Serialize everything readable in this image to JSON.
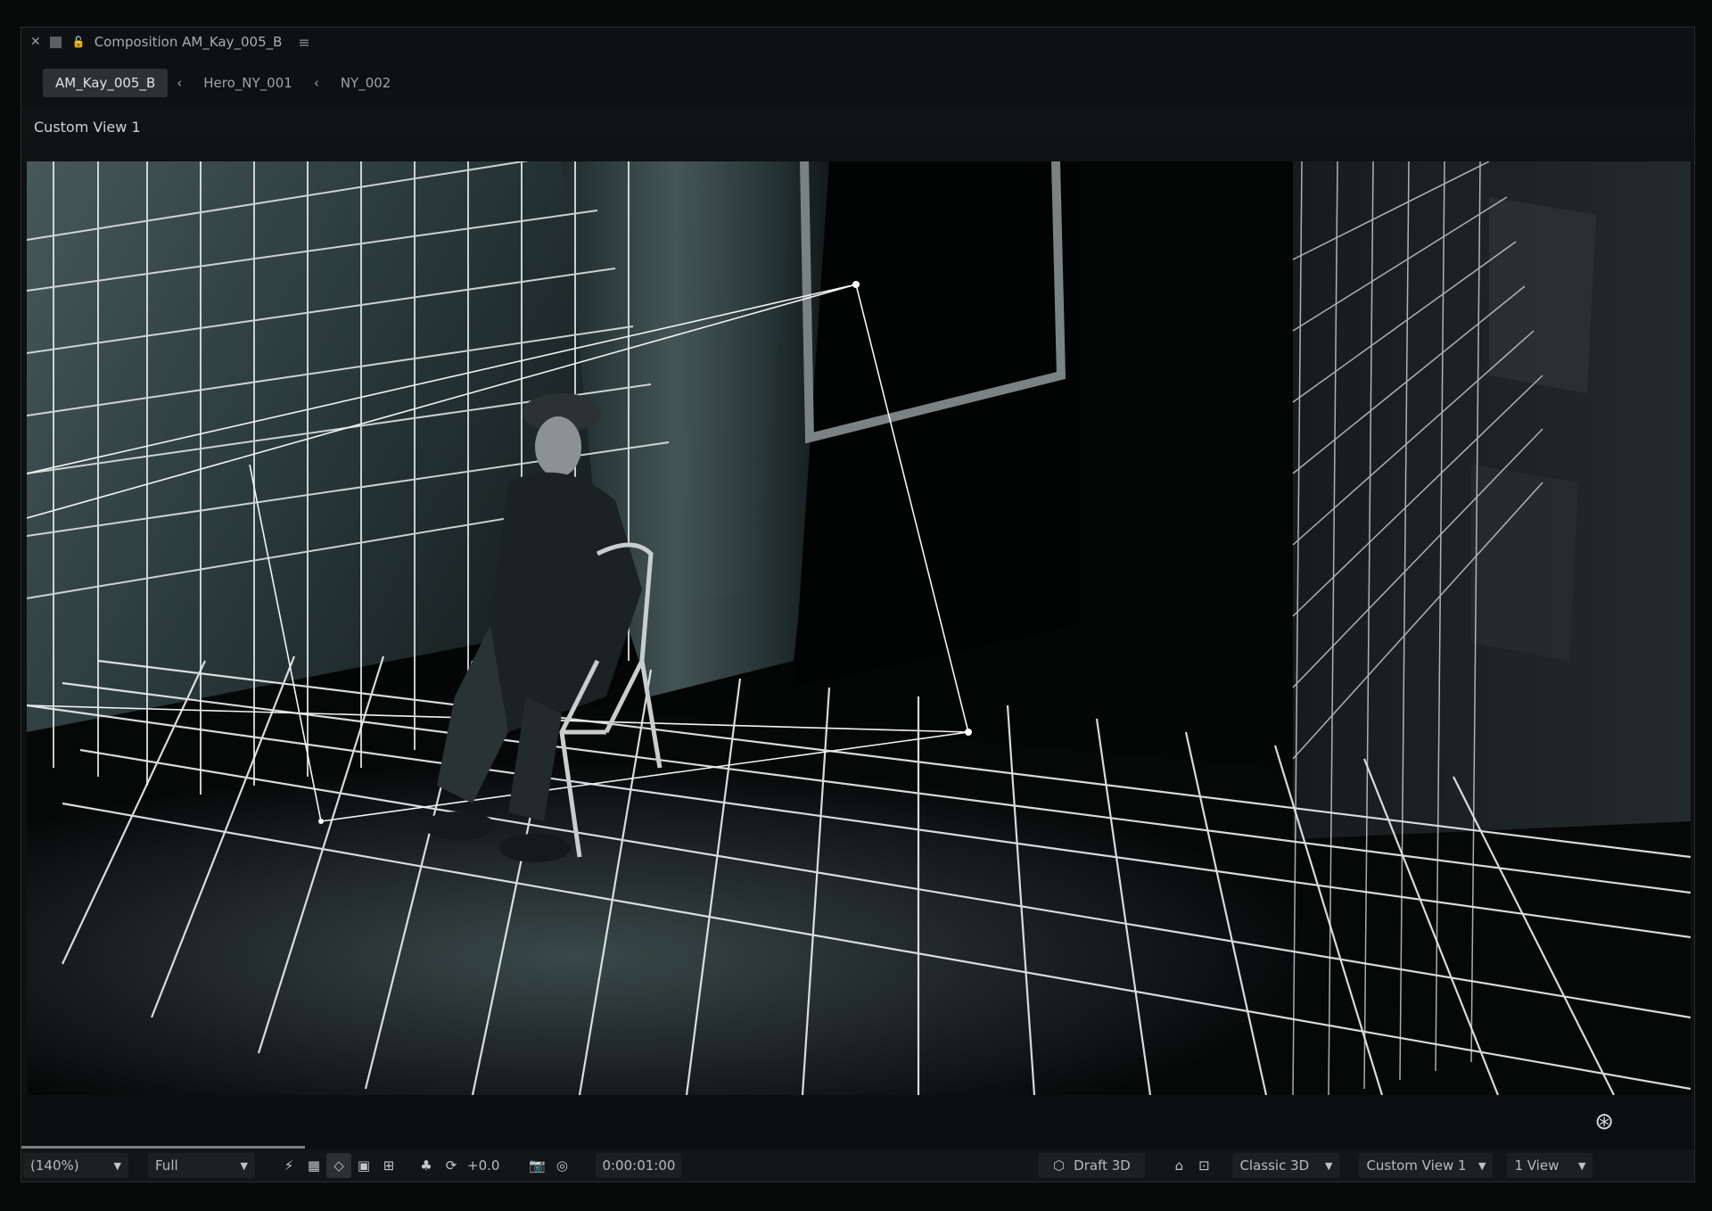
{
  "titlebar": {
    "title": "Composition AM_Kay_005_B",
    "close_icon": "close-icon",
    "menu_icon": "hamburger-icon"
  },
  "tabs": [
    {
      "label": "AM_Kay_005_B",
      "active": true
    },
    {
      "label": "Hero_NY_001",
      "active": false
    },
    {
      "label": "NY_002",
      "active": false
    }
  ],
  "viewer": {
    "view_label": "Custom View 1"
  },
  "toolbar": {
    "zoom": "(140%)",
    "resolution": "Full",
    "exposure": "+0.0",
    "timecode": "0:00:01:00",
    "renderer_mode": "Draft 3D",
    "renderer": "Classic 3D",
    "view": "Custom View 1",
    "view_count": "1 View"
  }
}
